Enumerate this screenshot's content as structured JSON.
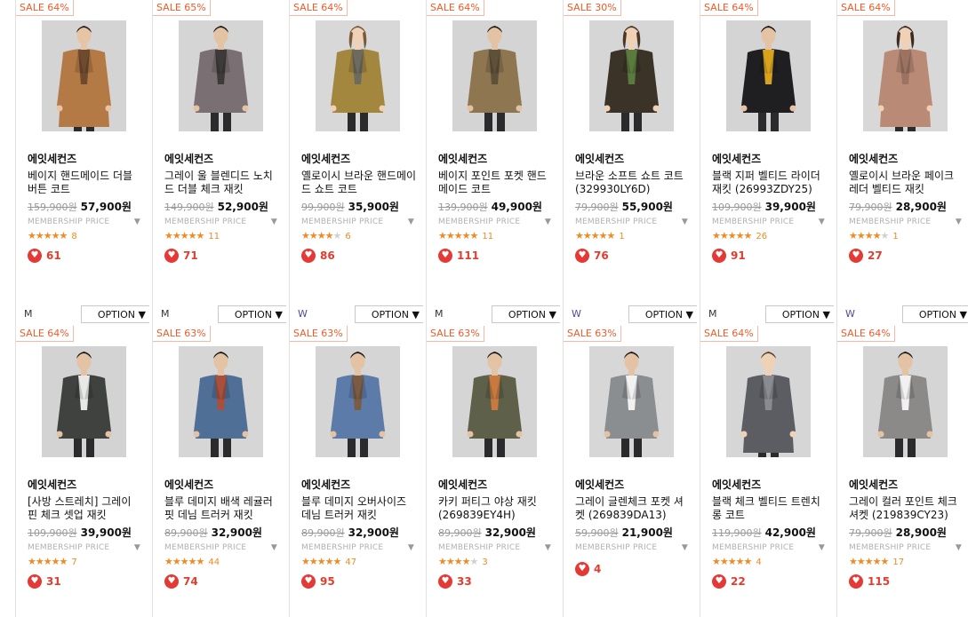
{
  "products": [
    {
      "sale": "SALE 64%",
      "brand": "에잇세컨즈",
      "name": "베이지 핸드메이드 더블 버튼 코트",
      "orig_price": "159,900원",
      "price": "57,900원",
      "membership": "MEMBERSHIP PRICE",
      "rating": 4.5,
      "review_count": "8",
      "likes": "61",
      "size": "M",
      "option": "OPTION ▼",
      "coat_color": "#b47a45",
      "inner_color": "#6e4a2e",
      "skin": "#e6c4a6",
      "hair": "#2a1d16",
      "bg": "#d4d4d4",
      "long": true
    },
    {
      "sale": "SALE 65%",
      "brand": "에잇세컨즈",
      "name": "그레이 울 블렌디드 노치드 더블 체크 재킷",
      "orig_price": "149,900원",
      "price": "52,900원",
      "membership": "MEMBERSHIP PRICE",
      "rating": 5,
      "review_count": "11",
      "likes": "71",
      "size": "M",
      "option": "OPTION ▼",
      "coat_color": "#7a6f72",
      "inner_color": "#3e3a3a",
      "skin": "#e4c2a4",
      "hair": "#1f1b1a",
      "bg": "#d5d5d5",
      "long": false
    },
    {
      "sale": "SALE 64%",
      "brand": "에잇세컨즈",
      "name": "옐로이시 브라운 핸드메이드 쇼트 코트",
      "orig_price": "99,900원",
      "price": "35,900원",
      "membership": "MEMBERSHIP PRICE",
      "rating": 3.5,
      "review_count": "6",
      "likes": "86",
      "size": "W",
      "option": "OPTION ▼",
      "coat_color": "#a3873f",
      "inner_color": "#6d6a5f",
      "skin": "#efd1b6",
      "hair": "#7a5a3d",
      "bg": "#d8d8d8",
      "long": false
    },
    {
      "sale": "SALE 64%",
      "brand": "에잇세컨즈",
      "name": "베이지 포인트 포켓 핸드메이드 코트",
      "orig_price": "139,900원",
      "price": "49,900원",
      "membership": "MEMBERSHIP PRICE",
      "rating": 5,
      "review_count": "11",
      "likes": "111",
      "size": "M",
      "option": "OPTION ▼",
      "coat_color": "#8e7650",
      "inner_color": "#5e513a",
      "skin": "#e4c2a4",
      "hair": "#231a14",
      "bg": "#d4d4d4",
      "long": false
    },
    {
      "sale": "SALE 30%",
      "brand": "에잇세컨즈",
      "name": "브라운 소프트 쇼트 코트 (329930LY6D)",
      "orig_price": "79,900원",
      "price": "55,900원",
      "membership": "MEMBERSHIP PRICE",
      "rating": 5,
      "review_count": "1",
      "likes": "76",
      "size": "W",
      "option": "OPTION ▼",
      "coat_color": "#3b3327",
      "inner_color": "#5a7a3e",
      "skin": "#efd1b6",
      "hair": "#4b3524",
      "bg": "#d6d6d6",
      "long": false
    },
    {
      "sale": "SALE 64%",
      "brand": "에잇세컨즈",
      "name": "블랙 지퍼 벨티드 라이더 재킷 (26993ZDY25)",
      "orig_price": "109,900원",
      "price": "39,900원",
      "membership": "MEMBERSHIP PRICE",
      "rating": 5,
      "review_count": "26",
      "likes": "91",
      "size": "M",
      "option": "OPTION ▼",
      "coat_color": "#1f1f22",
      "inner_color": "#d9a21d",
      "skin": "#e4c2a4",
      "hair": "#1a1614",
      "bg": "#d4d4d4",
      "long": false
    },
    {
      "sale": "SALE 64%",
      "brand": "에잇세컨즈",
      "name": "옐로이시 브라운 페이크 레더 벨티드 재킷",
      "orig_price": "79,900원",
      "price": "28,900원",
      "membership": "MEMBERSHIP PRICE",
      "rating": 3.5,
      "review_count": "1",
      "likes": "27",
      "size": "W",
      "option": "OPTION ▼",
      "coat_color": "#b98b76",
      "inner_color": "#9c7262",
      "skin": "#efd1b6",
      "hair": "#3b2a20",
      "bg": "#d8d8d8",
      "long": true
    },
    {
      "sale": "SALE 64%",
      "brand": "에잇세컨즈",
      "name": "[사방 스트레치] 그레이 핀 체크 셋업 재킷",
      "orig_price": "109,900원",
      "price": "39,900원",
      "membership": "MEMBERSHIP PRICE",
      "rating": 4.5,
      "review_count": "7",
      "likes": "31",
      "coat_color": "#3f423f",
      "inner_color": "#e8e8e8",
      "skin": "#e4c2a4",
      "hair": "#1d1815",
      "bg": "#d3d3d3",
      "long": false
    },
    {
      "sale": "SALE 63%",
      "brand": "에잇세컨즈",
      "name": "블루 데미지 배색 레귤러핏 데님 트러커 재킷",
      "orig_price": "89,900원",
      "price": "32,900원",
      "membership": "MEMBERSHIP PRICE",
      "rating": 5,
      "review_count": "44",
      "likes": "74",
      "coat_color": "#4f6f96",
      "inner_color": "#a7503c",
      "skin": "#e4c2a4",
      "hair": "#1d1815",
      "bg": "#d6d6d6",
      "long": false
    },
    {
      "sale": "SALE 63%",
      "brand": "에잇세컨즈",
      "name": "블루 데미지 오버사이즈 데님 트러커 재킷",
      "orig_price": "89,900원",
      "price": "32,900원",
      "membership": "MEMBERSHIP PRICE",
      "rating": 5,
      "review_count": "47",
      "likes": "95",
      "coat_color": "#5c7ba8",
      "inner_color": "#7b5b43",
      "skin": "#e4c2a4",
      "hair": "#1d1815",
      "bg": "#d5d5d5",
      "long": false
    },
    {
      "sale": "SALE 63%",
      "brand": "에잇세컨즈",
      "name": "카키 퍼티그 야상 재킷 (269839EY4H)",
      "orig_price": "89,900원",
      "price": "32,900원",
      "membership": "MEMBERSHIP PRICE",
      "rating": 3.5,
      "review_count": "3",
      "likes": "33",
      "coat_color": "#5e6049",
      "inner_color": "#c7793f",
      "skin": "#e4c2a4",
      "hair": "#1d1815",
      "bg": "#d5d5d5",
      "long": false
    },
    {
      "sale": "SALE 63%",
      "brand": "에잇세컨즈",
      "name": "그레이 글렌체크 포켓 셔켓 (269839DA13)",
      "orig_price": "59,900원",
      "price": "21,900원",
      "membership": "MEMBERSHIP PRICE",
      "rating": 0,
      "review_count": "",
      "likes": "4",
      "coat_color": "#8b8e91",
      "inner_color": "#f1f1f1",
      "skin": "#e4c2a4",
      "hair": "#1d1815",
      "bg": "#d7d7d7",
      "long": false
    },
    {
      "sale": "SALE 64%",
      "brand": "에잇세컨즈",
      "name": "블랙 체크 벨티드 트렌치 롱 코트",
      "orig_price": "119,900원",
      "price": "42,900원",
      "membership": "MEMBERSHIP PRICE",
      "rating": 4.5,
      "review_count": "4",
      "likes": "22",
      "coat_color": "#5c5d63",
      "inner_color": "#8a8b91",
      "skin": "#efd1b6",
      "hair": "#5a3f2a",
      "bg": "#d6d6d6",
      "long": true
    },
    {
      "sale": "SALE 64%",
      "brand": "에잇세컨즈",
      "name": "그레이 컬러 포인트 체크 셔켓 (219839CY23)",
      "orig_price": "79,900원",
      "price": "28,900원",
      "membership": "MEMBERSHIP PRICE",
      "rating": 4.5,
      "review_count": "17",
      "likes": "115",
      "coat_color": "#8c8a88",
      "inner_color": "#f1f1f1",
      "skin": "#e4c2a4",
      "hair": "#1d1815",
      "bg": "#d5d5d5",
      "long": false
    }
  ],
  "icons": {
    "heart": "heart-icon",
    "caret": "caret-down-icon",
    "star": "star-icon"
  },
  "colors": {
    "sale": "#f05a28",
    "star": "#f08a24",
    "heart": "#e53935",
    "like_text": "#e23c2e"
  }
}
